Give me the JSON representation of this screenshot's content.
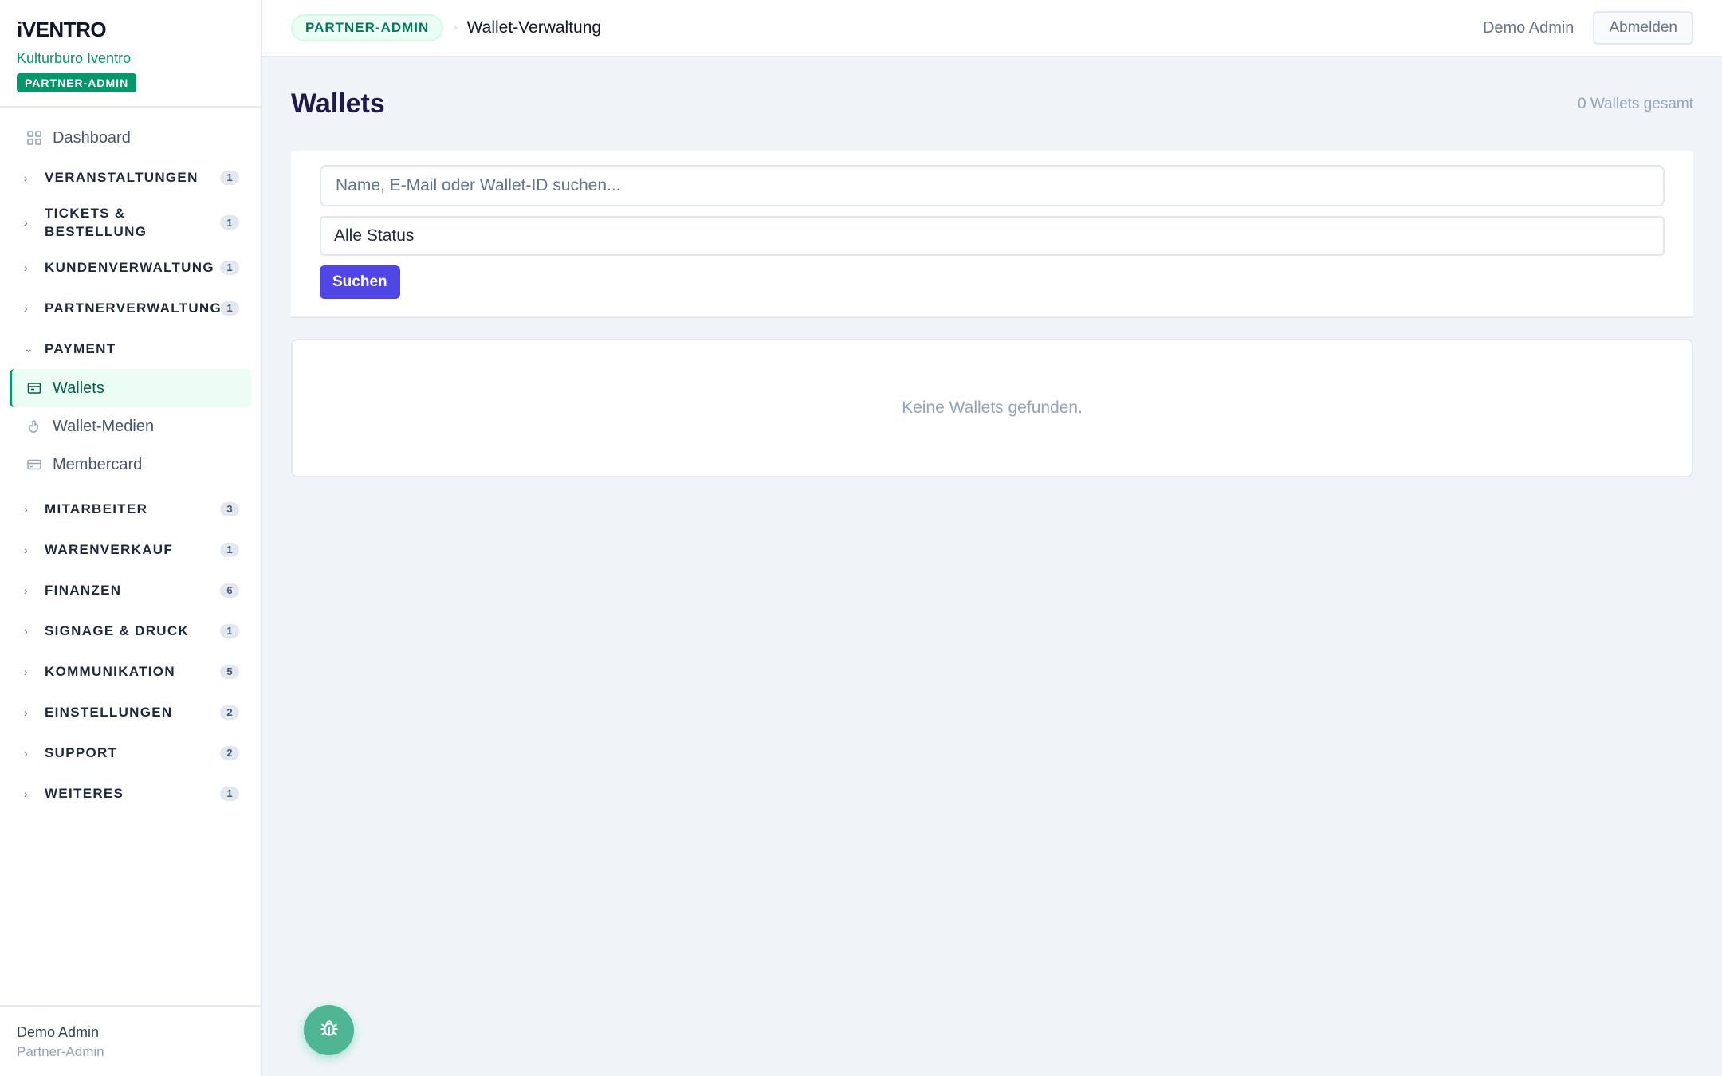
{
  "brand": {
    "logo": "iVENTRO",
    "organization": "Kulturbüro Iventro",
    "role_badge": "PARTNER-ADMIN"
  },
  "sidebar": {
    "dashboard": {
      "label": "Dashboard",
      "icon": "grid-icon"
    },
    "groups": [
      {
        "label": "VERANSTALTUNGEN",
        "count": "1"
      },
      {
        "label": "TICKETS & BESTELLUNG",
        "count": "1"
      },
      {
        "label": "KUNDENVERWALTUNG",
        "count": "1"
      },
      {
        "label": "PARTNERVERWALTUNG",
        "count": "1"
      },
      {
        "label": "PAYMENT",
        "expanded": true
      },
      {
        "label": "MITARBEITER",
        "count": "3"
      },
      {
        "label": "WARENVERKAUF",
        "count": "1"
      },
      {
        "label": "FINANZEN",
        "count": "6"
      },
      {
        "label": "SIGNAGE & DRUCK",
        "count": "1"
      },
      {
        "label": "KOMMUNIKATION",
        "count": "5"
      },
      {
        "label": "EINSTELLUNGEN",
        "count": "2"
      },
      {
        "label": "SUPPORT",
        "count": "2"
      },
      {
        "label": "WEITERES",
        "count": "1"
      }
    ],
    "payment_items": [
      {
        "label": "Wallets",
        "icon": "wallet-icon",
        "active": true
      },
      {
        "label": "Wallet-Medien",
        "icon": "tap-icon"
      },
      {
        "label": "Membercard",
        "icon": "card-icon"
      }
    ],
    "footer": {
      "name": "Demo Admin",
      "role": "Partner-Admin"
    }
  },
  "topbar": {
    "badge": "PARTNER-ADMIN",
    "separator": "›",
    "title": "Wallet-Verwaltung",
    "user": "Demo Admin",
    "logout_label": "Abmelden"
  },
  "page": {
    "title": "Wallets",
    "count_text": "0 Wallets gesamt",
    "search": {
      "placeholder": "Name, E-Mail oder Wallet-ID suchen...",
      "value": ""
    },
    "status_select": {
      "selected": "Alle Status"
    },
    "search_button": "Suchen",
    "empty_message": "Keine Wallets gefunden."
  },
  "fab": {
    "icon": "bug-icon"
  },
  "colors": {
    "brand_green": "#059669",
    "primary_button": "#4f46e5",
    "fab": "#4fb592",
    "active_nav_bg": "#ecfdf5"
  }
}
